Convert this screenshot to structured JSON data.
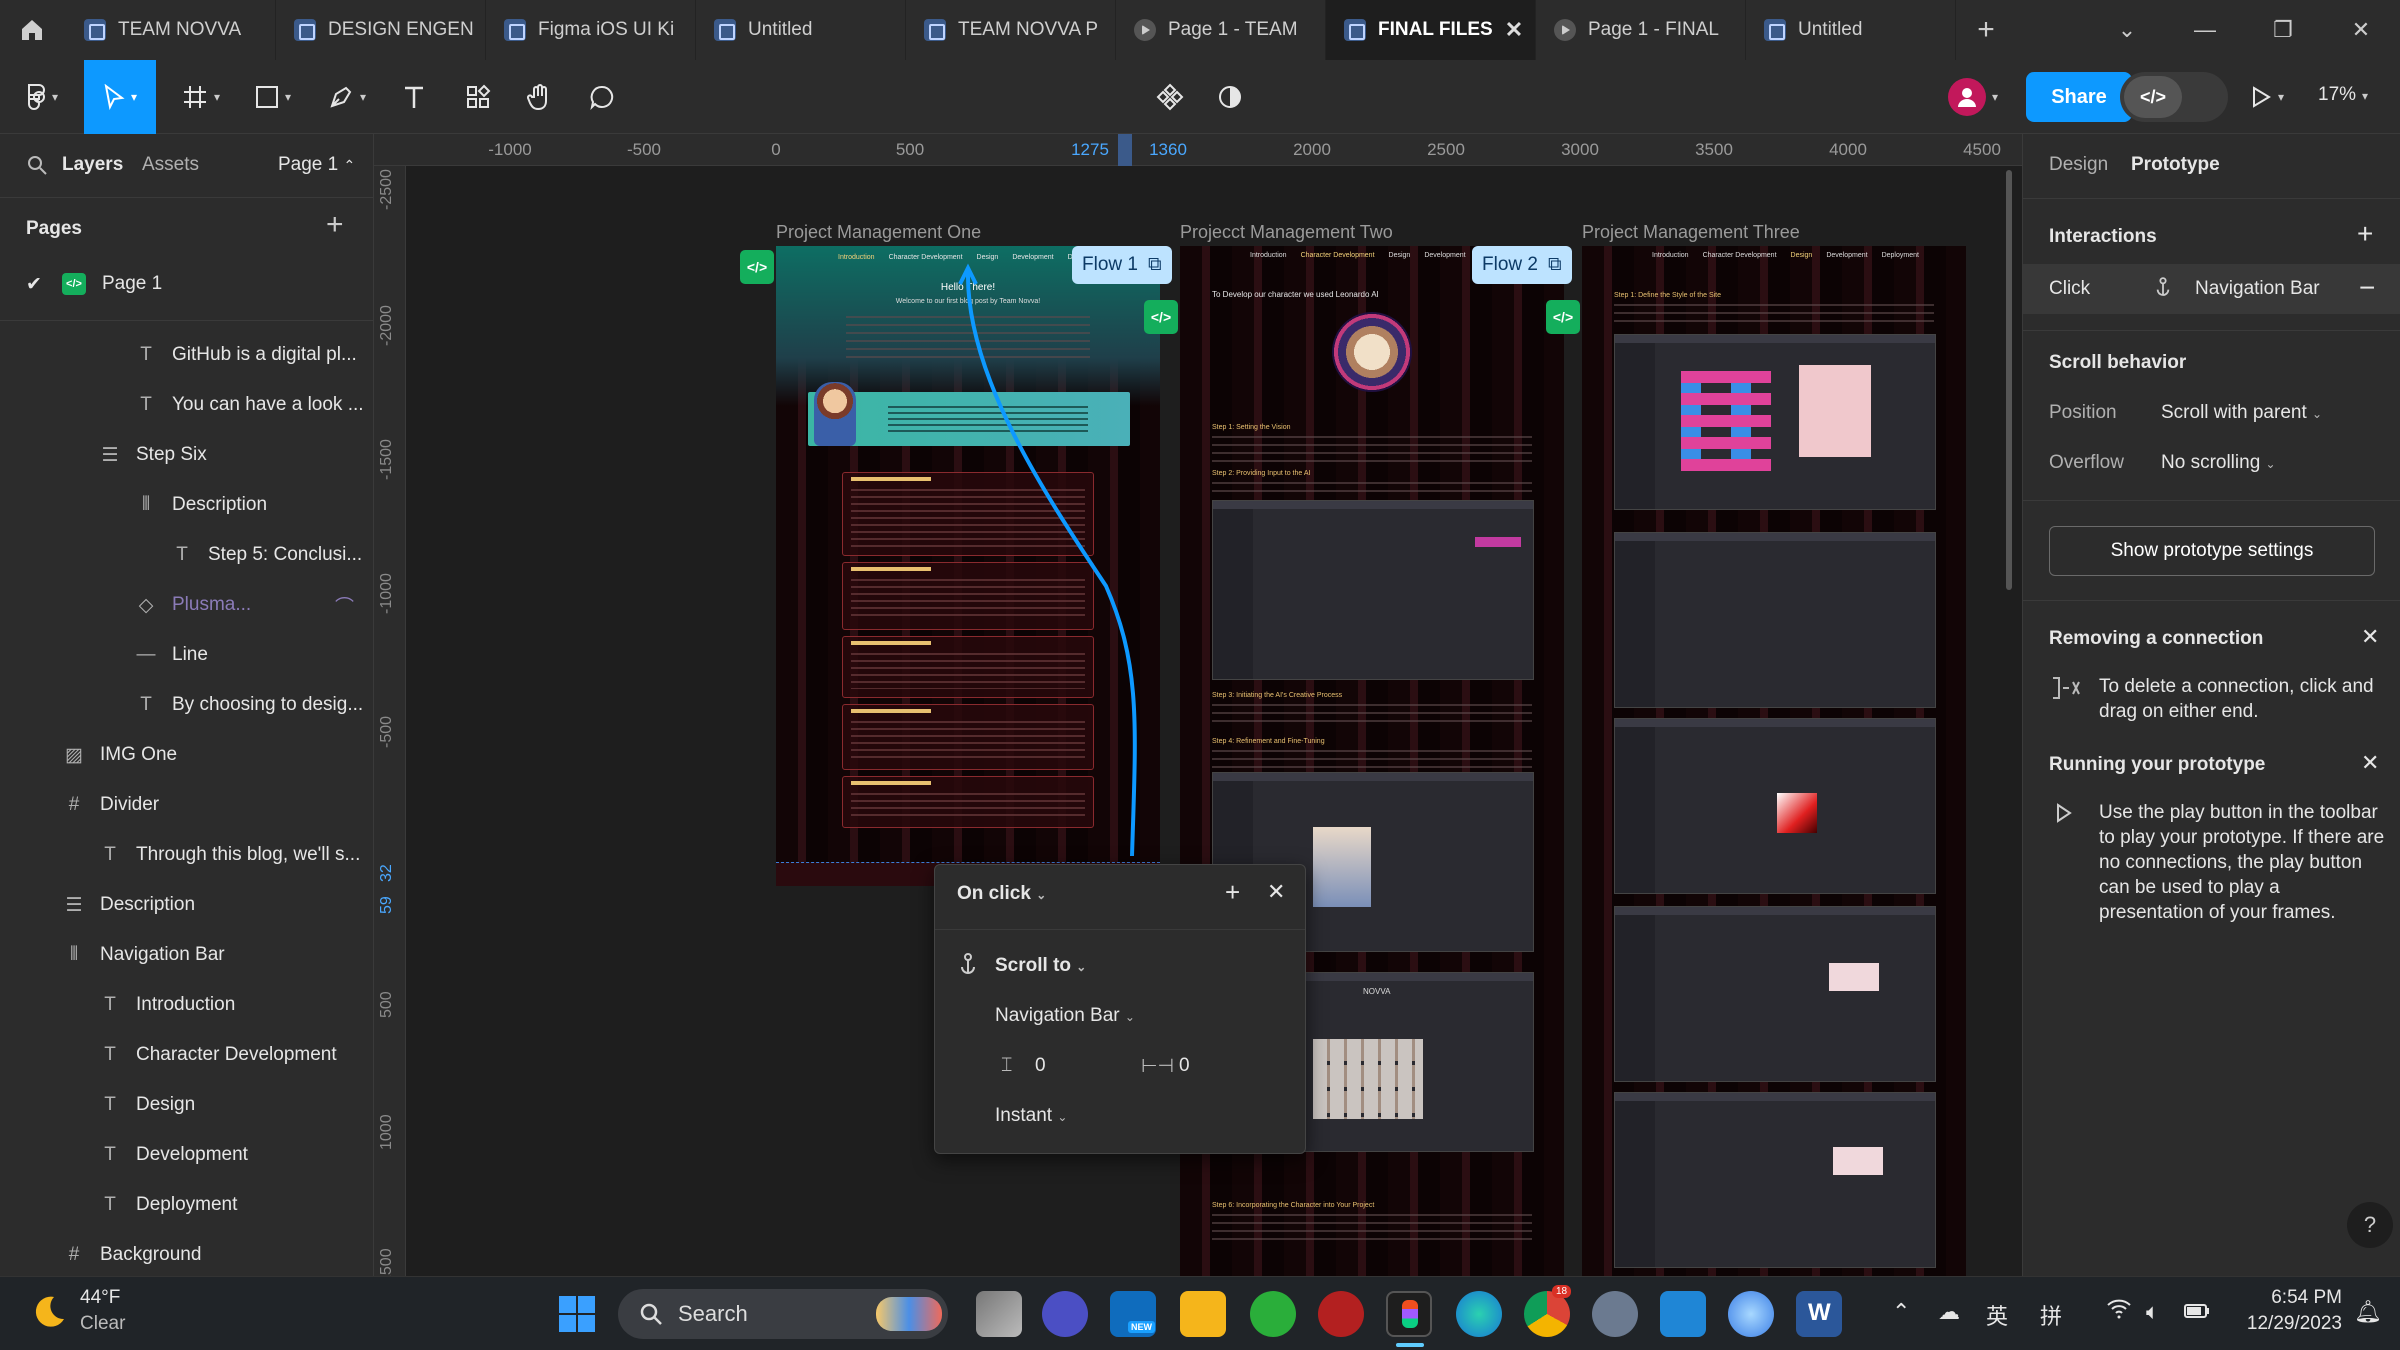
{
  "tabs": [
    {
      "label": "TEAM NOVVA",
      "icon": "figma-file-icon",
      "active": false
    },
    {
      "label": "DESIGN ENGEN",
      "icon": "figma-file-icon",
      "active": false
    },
    {
      "label": "Figma iOS UI Ki",
      "icon": "figma-file-icon",
      "active": false
    },
    {
      "label": "Untitled",
      "icon": "figma-file-icon",
      "active": false
    },
    {
      "label": "TEAM NOVVA P",
      "icon": "figma-file-icon",
      "active": false
    },
    {
      "label": "Page 1 - TEAM",
      "icon": "play-prototype-icon",
      "active": false
    },
    {
      "label": "FINAL FILES",
      "icon": "figma-file-icon",
      "active": true
    },
    {
      "label": "Page 1 - FINAL",
      "icon": "play-prototype-icon",
      "active": false
    },
    {
      "label": "Untitled",
      "icon": "figma-file-icon",
      "active": false
    }
  ],
  "toolbar": {
    "share_label": "Share",
    "zoom": "17%",
    "accent": "#0d99ff"
  },
  "left_panel": {
    "tab_layers": "Layers",
    "tab_assets": "Assets",
    "page_selector": "Page 1",
    "pages_title": "Pages",
    "current_page": "Page 1",
    "layers": [
      {
        "label": "GitHub is a digital pl...",
        "icon": "text-icon",
        "indent": 2
      },
      {
        "label": "You can have a look ...",
        "icon": "text-icon",
        "indent": 2
      },
      {
        "label": "Step Six",
        "icon": "auto-layout-vertical-icon",
        "indent": 1
      },
      {
        "label": "Description",
        "icon": "auto-layout-horizontal-icon",
        "indent": 2
      },
      {
        "label": "Step 5: Conclusi...",
        "icon": "text-icon",
        "indent": 3
      },
      {
        "label": "Plusma...",
        "icon": "component-instance-icon",
        "indent": 2
      },
      {
        "label": "Line",
        "icon": "line-icon",
        "indent": 2
      },
      {
        "label": "By choosing to desig...",
        "icon": "text-icon",
        "indent": 2
      },
      {
        "label": "IMG One",
        "icon": "image-icon",
        "indent": 0
      },
      {
        "label": "Divider",
        "icon": "frame-icon",
        "indent": 0
      },
      {
        "label": "Through this blog, we'll s...",
        "icon": "text-icon",
        "indent": 1
      },
      {
        "label": "Description",
        "icon": "auto-layout-vertical-icon",
        "indent": 0
      },
      {
        "label": "Navigation Bar",
        "icon": "auto-layout-horizontal-icon",
        "indent": 0
      },
      {
        "label": "Introduction",
        "icon": "text-icon",
        "indent": 1
      },
      {
        "label": "Character Development",
        "icon": "text-icon",
        "indent": 1
      },
      {
        "label": "Design",
        "icon": "text-icon",
        "indent": 1
      },
      {
        "label": "Development",
        "icon": "text-icon",
        "indent": 1
      },
      {
        "label": "Deployment",
        "icon": "text-icon",
        "indent": 1
      },
      {
        "label": "Background",
        "icon": "frame-icon",
        "indent": 0
      }
    ]
  },
  "ruler": {
    "top": [
      "-1000",
      "-500",
      "0",
      "500",
      "1275",
      "1360",
      "2000",
      "2500",
      "3000",
      "3500",
      "4000",
      "4500"
    ],
    "left": [
      "-2500",
      "-2000",
      "-1500",
      "-1000",
      "-500",
      "32",
      "59",
      "500",
      "1000",
      "1500"
    ]
  },
  "canvas": {
    "frames": [
      {
        "label": "Project Management One"
      },
      {
        "label": "Projecct Management Two"
      },
      {
        "label": "Project Management Three"
      }
    ],
    "flow1": "Flow 1",
    "flow2": "Flow 2",
    "frame_one_nav": [
      "Introduction",
      "Character Development",
      "Design",
      "Development",
      "Deployment"
    ],
    "frame_one_heading": "Hello There!",
    "frame_one_subheading": "Welcome to our first blog post by Team Novva!",
    "frame_one_steps": [
      "Step 1: Introducing Our Friend \"NOVVA\"",
      "Step 2: Getting Creative",
      "Step 3: Let's Code!",
      "Step 4: Github",
      "Step 5: Conclusion"
    ],
    "frame_two_intro": "To Develop our character we used Leonardo AI",
    "frame_two_steps": [
      "Step 1: Setting the Vision",
      "Step 2: Providing Input to the AI",
      "Step 3: Initiating the AI's Creative Process",
      "Step 4: Refinement and Fine-Tuning",
      "Step 6: Incorporating the Character into Your Project"
    ],
    "frame_two_mock_title": "NOVVA",
    "frame_three_step": "Step 1: Define the Style of the Site"
  },
  "popup": {
    "trigger": "On click",
    "action": "Scroll to",
    "target": "Navigation Bar",
    "offset_y": "0",
    "offset_x": "0",
    "animation": "Instant"
  },
  "right_panel": {
    "tab_design": "Design",
    "tab_prototype": "Prototype",
    "interactions_title": "Interactions",
    "interaction_trigger": "Click",
    "interaction_target": "Navigation Bar",
    "scroll_behavior_title": "Scroll behavior",
    "position_label": "Position",
    "position_value": "Scroll with parent",
    "overflow_label": "Overflow",
    "overflow_value": "No scrolling",
    "proto_settings_button": "Show prototype settings",
    "removing_title": "Removing a connection",
    "removing_text": "To delete a connection, click and drag on either end.",
    "running_title": "Running your prototype",
    "running_text": "Use the play button in the toolbar to play your prototype. If there are no connections, the play button can be used to play a presentation of your frames."
  },
  "taskbar": {
    "weather_temp": "44°F",
    "weather_cond": "Clear",
    "search_label": "Search",
    "ime_lang": "英",
    "ime_mode": "拼",
    "time": "6:54 PM",
    "date": "12/29/2023",
    "mail_badge": "NEW",
    "chrome_badge": "18"
  }
}
